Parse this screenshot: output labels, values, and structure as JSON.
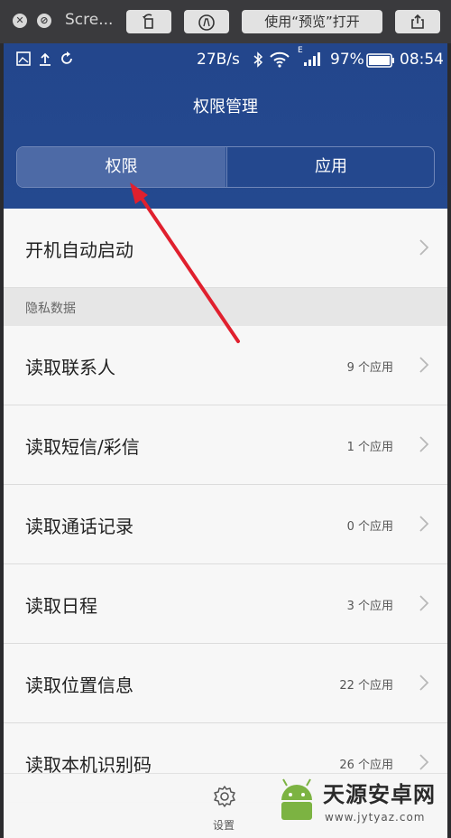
{
  "mac_toolbar": {
    "title": "Scre...",
    "open_with_preview": "使用“预览”打开"
  },
  "status_bar": {
    "speed": "27B/s",
    "signal_label": "E",
    "battery": "97%",
    "time": "08:54"
  },
  "header": {
    "title": "权限管理",
    "tabs": [
      {
        "label": "权限",
        "active": true
      },
      {
        "label": "应用",
        "active": false
      }
    ]
  },
  "list": {
    "autostart": {
      "label": "开机自动启动"
    },
    "section": "隐私数据",
    "items": [
      {
        "label": "读取联系人",
        "count": "9 个应用"
      },
      {
        "label": "读取短信/彩信",
        "count": "1 个应用"
      },
      {
        "label": "读取通话记录",
        "count": "0 个应用"
      },
      {
        "label": "读取日程",
        "count": "3 个应用"
      },
      {
        "label": "读取位置信息",
        "count": "22 个应用"
      },
      {
        "label": "读取本机识别码",
        "count": "26 个应用"
      }
    ]
  },
  "bottom_bar": {
    "settings_label": "设置",
    "settings_icon": "gear-icon"
  },
  "watermark": {
    "text": "天源安卓网",
    "url": "www.jytyaz.com"
  },
  "colors": {
    "header_bg": "#24478f",
    "tab_active_bg": "#4d6aa6",
    "arrow": "#e0202e"
  }
}
